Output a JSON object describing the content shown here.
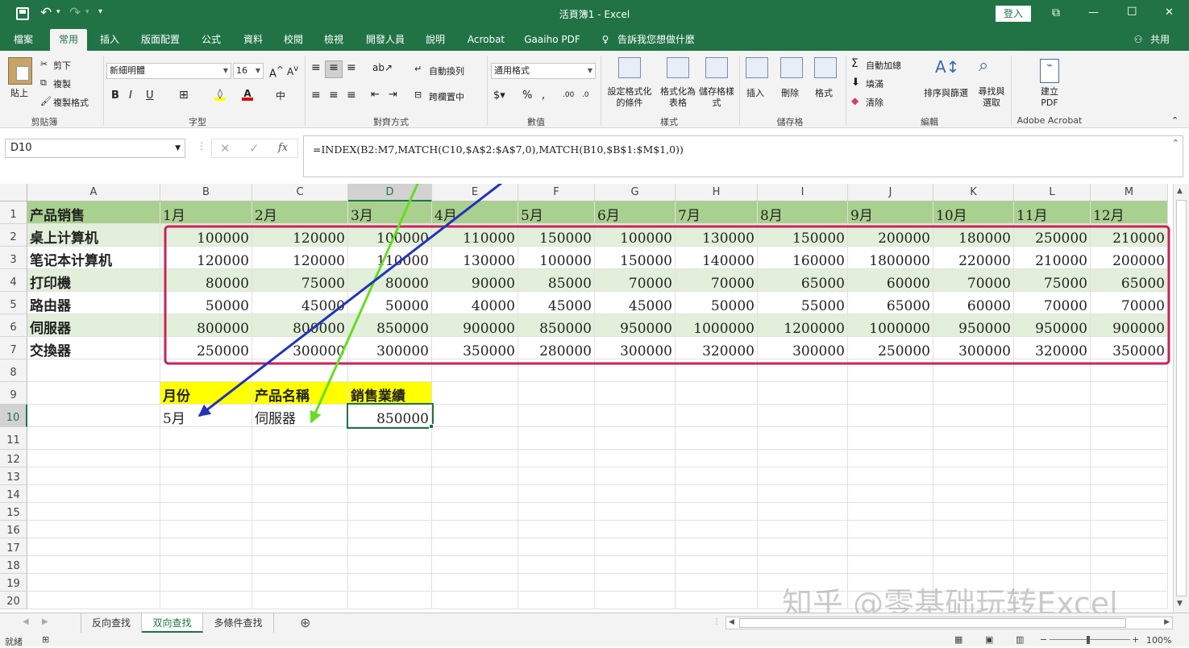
{
  "titlebar": {
    "title": "活頁簿1 - Excel",
    "login": "登入",
    "minimize": "—",
    "restore": "☐",
    "close": "✕",
    "ribbon_display": "⧉",
    "qat_dropdown": "▾"
  },
  "tabs": {
    "items": [
      "檔案",
      "常用",
      "插入",
      "版面配置",
      "公式",
      "資料",
      "校閱",
      "檢視",
      "開發人員",
      "說明",
      "Acrobat",
      "Gaaiho PDF"
    ],
    "active": "常用",
    "tell_me": "告訴我您想做什麼",
    "share": "共用"
  },
  "ribbon": {
    "clipboard": {
      "paste": "貼上",
      "cut": "剪下",
      "copy": "複製",
      "format_painter": "複製格式",
      "label": "剪貼簿"
    },
    "font": {
      "name": "新細明體",
      "size": "16",
      "bold": "B",
      "italic": "I",
      "underline": "U",
      "label": "字型"
    },
    "alignment": {
      "wrap": "自動換列",
      "merge": "跨欄置中",
      "label": "對齊方式"
    },
    "number": {
      "format": "通用格式",
      "label": "數值"
    },
    "styles": {
      "conditional": "設定格式化的條件",
      "as_table": "格式化為表格",
      "cell_styles": "儲存格樣式",
      "label": "樣式"
    },
    "cells": {
      "insert": "插入",
      "delete": "刪除",
      "format": "格式",
      "label": "儲存格"
    },
    "editing": {
      "autosum": "自動加總",
      "fill": "填滿",
      "clear": "清除",
      "sort": "排序與篩選",
      "find": "尋找與選取",
      "label": "編輯"
    },
    "acrobat": {
      "create": "建立PDF",
      "label": "Adobe Acrobat"
    }
  },
  "formula_bar": {
    "name_box": "D10",
    "fx": "fx",
    "formula": "=INDEX(B2:M7,MATCH(C10,$A$2:$A$7,0),MATCH(B10,$B$1:$M$1,0))"
  },
  "grid": {
    "columns": [
      "A",
      "B",
      "C",
      "D",
      "E",
      "F",
      "G",
      "H",
      "I",
      "J",
      "K",
      "L",
      "M"
    ],
    "selected_col": "D",
    "selected_row": "10",
    "rows": [
      "1",
      "2",
      "3",
      "4",
      "5",
      "6",
      "7",
      "8",
      "9",
      "10",
      "11",
      "12",
      "13",
      "14",
      "15",
      "16",
      "17",
      "18",
      "19",
      "20"
    ],
    "header_row": [
      "产品销售",
      "1月",
      "2月",
      "3月",
      "4月",
      "5月",
      "6月",
      "7月",
      "8月",
      "9月",
      "10月",
      "11月",
      "12月"
    ],
    "data": [
      {
        "product": "桌上计算机",
        "values": [
          "100000",
          "120000",
          "100000",
          "110000",
          "150000",
          "100000",
          "130000",
          "150000",
          "200000",
          "180000",
          "250000",
          "210000"
        ]
      },
      {
        "product": "笔记本计算机",
        "values": [
          "120000",
          "120000",
          "110000",
          "130000",
          "100000",
          "150000",
          "140000",
          "160000",
          "1800000",
          "220000",
          "210000",
          "200000"
        ]
      },
      {
        "product": "打印機",
        "values": [
          "80000",
          "75000",
          "80000",
          "90000",
          "85000",
          "70000",
          "70000",
          "65000",
          "60000",
          "70000",
          "75000",
          "65000"
        ]
      },
      {
        "product": "路由器",
        "values": [
          "50000",
          "45000",
          "50000",
          "40000",
          "45000",
          "45000",
          "50000",
          "55000",
          "65000",
          "60000",
          "70000",
          "70000"
        ]
      },
      {
        "product": "伺服器",
        "values": [
          "800000",
          "800000",
          "850000",
          "900000",
          "850000",
          "950000",
          "1000000",
          "1200000",
          "1000000",
          "950000",
          "950000",
          "900000"
        ]
      },
      {
        "product": "交換器",
        "values": [
          "250000",
          "300000",
          "300000",
          "350000",
          "280000",
          "300000",
          "320000",
          "300000",
          "250000",
          "300000",
          "320000",
          "350000"
        ]
      }
    ],
    "lookup": {
      "h_month": "月份",
      "h_product": "产品名稱",
      "h_sales": "銷售業績",
      "month": "5月",
      "product": "伺服器",
      "result": "850000"
    }
  },
  "sheets": {
    "tabs": [
      "反向查找",
      "双向查找",
      "多條件查找"
    ],
    "active": "双向查找",
    "add": "⊕"
  },
  "status": {
    "ready": "就緒",
    "zoom": "100%"
  },
  "colors": {
    "brand": "#217346",
    "header_fill": "#a9d08e",
    "band_fill": "#e2efda",
    "yellow": "#ffff00",
    "magenta": "#c8235a",
    "green_arrow": "#66dd22",
    "blue_arrow": "#2233bb"
  },
  "watermark": "知乎 @零基础玩转Excel"
}
